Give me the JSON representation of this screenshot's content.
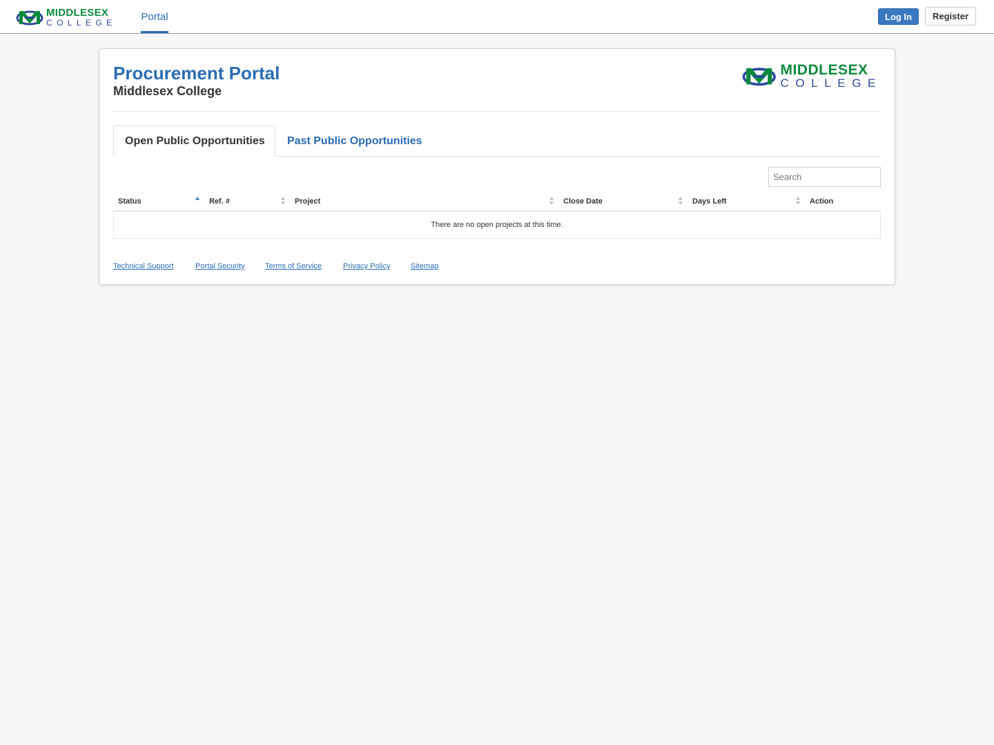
{
  "header": {
    "logo": {
      "line1": "MIDDLESEX",
      "line2": "COLLEGE"
    },
    "nav_portal": "Portal",
    "login_label": "Log In",
    "register_label": "Register"
  },
  "card": {
    "title": "Procurement Portal",
    "subtitle": "Middlesex College",
    "logo": {
      "line1": "MIDDLESEX",
      "line2": "COLLEGE"
    }
  },
  "tabs": {
    "open": "Open Public Opportunities",
    "past": "Past Public Opportunities"
  },
  "search": {
    "placeholder": "Search"
  },
  "table": {
    "columns": [
      "Status",
      "Ref. #",
      "Project",
      "Close Date",
      "Days Left",
      "Action"
    ],
    "sorted_column": "Status",
    "sort_direction": "ascending",
    "empty_message": "There are no open projects at this time."
  },
  "footer": {
    "links": [
      "Technical Support",
      "Portal Security",
      "Terms of Service",
      "Privacy Policy",
      "Sitemap"
    ]
  },
  "colors": {
    "link_blue": "#2a6cb5",
    "login_button": "#3b78c2",
    "logo_green": "#0c8a3c",
    "logo_blue": "#2b4a9a",
    "sort_active": "#4a90c8",
    "sort_inactive": "#c8c8c8"
  }
}
